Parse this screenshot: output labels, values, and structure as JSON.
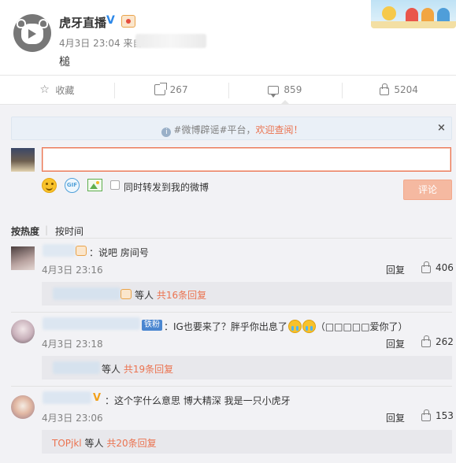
{
  "post": {
    "author": "虎牙直播",
    "verified_mark": "V",
    "time": "4月3日 23:04 来自",
    "text": "槌"
  },
  "actions": {
    "favorite": "收藏",
    "share": "267",
    "comment": "859",
    "like": "5204"
  },
  "notice": {
    "prefix": "#微博辟谣#平台，",
    "link": "欢迎查阅！"
  },
  "composer": {
    "input_value": "",
    "gif_label": "GIF",
    "forward_label": "同时转发到我的微博",
    "submit_label": "评论"
  },
  "sort": {
    "hot": "按热度",
    "time": "按时间",
    "separator": "|"
  },
  "comments": [
    {
      "text": "：说吧 房间号",
      "time": "4月3日 23:16",
      "reply_label": "回复",
      "likes": "406",
      "sub": {
        "suffix": "等人",
        "link": "共16条回复"
      }
    },
    {
      "fan_badge": "铁粉",
      "text": "：IG也要来了？胖乎你出息了",
      "text_tail": "（□□□□□爱你了）",
      "time": "4月3日 23:18",
      "reply_label": "回复",
      "likes": "262",
      "sub": {
        "suffix": "等人",
        "link": "共19条回复"
      }
    },
    {
      "verified_mark": "V",
      "text": "：这个字什么意思  博大精深 我是一只小虎牙",
      "time": "4月3日 23:06",
      "reply_label": "回复",
      "likes": "153",
      "sub": {
        "name": "TOPjkl",
        "suffix": "等人",
        "link": "共20条回复"
      }
    }
  ],
  "colors": {
    "accent": "#eb7350",
    "link_blue": "#2d88e8",
    "panel_bg": "#f2f2f5",
    "reply_box_bg": "#e8e8ec"
  }
}
